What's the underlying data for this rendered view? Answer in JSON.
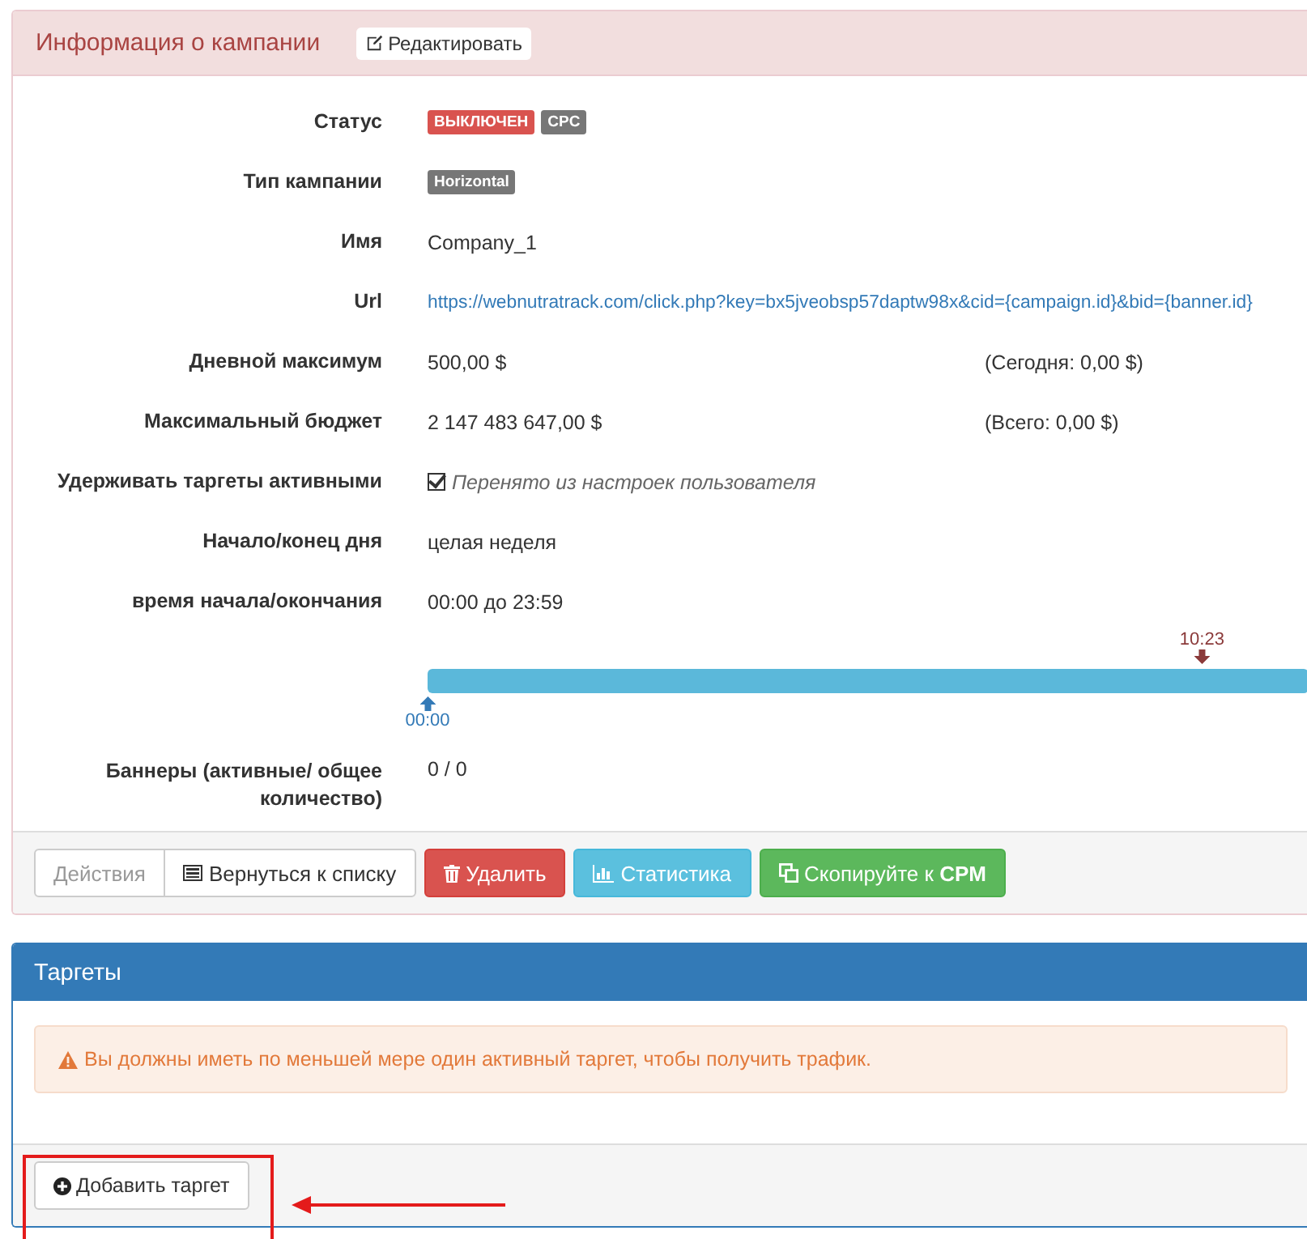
{
  "info_panel": {
    "title": "Информация о кампании",
    "edit_button": "Редактировать",
    "rows": [
      {
        "kind": "badges",
        "label": "Статус",
        "badges": [
          {
            "text": "ВЫКЛЮЧЕН",
            "color": "#d9534f"
          },
          {
            "text": "CPC",
            "color": "#777777"
          }
        ]
      },
      {
        "kind": "badges",
        "label": "Тип кампании",
        "badges": [
          {
            "text": "Horizontal",
            "color": "#777777"
          }
        ]
      },
      {
        "kind": "text",
        "label": "Имя",
        "value": "Company_1"
      },
      {
        "kind": "link",
        "label": "Url",
        "value": "https://webnutratrack.com/click.php?key=bx5jveobsp57daptw98x&cid={campaign.id}&bid={banner.id}"
      },
      {
        "kind": "amount",
        "label": "Дневной максимум",
        "value": "500,00 $",
        "note": "(Сегодня: 0,00 $)"
      },
      {
        "kind": "amount",
        "label": "Максимальный бюджет",
        "value": "2 147 483 647,00 $",
        "note": "(Всего: 0,00 $)"
      },
      {
        "kind": "check",
        "label": "Удерживать таргеты активными",
        "checked": true,
        "value": "Перенято из настроек пользователя"
      },
      {
        "kind": "text",
        "label": "Начало/конец дня",
        "value": "целая неделя"
      },
      {
        "kind": "text",
        "label": "время начала/окончания",
        "value": "00:00 до 23:59"
      },
      {
        "kind": "timeline",
        "now_label": "10:23",
        "level": 0.879,
        "start_label": "00:00"
      },
      {
        "kind": "text",
        "label": "Баннеры (активные/ общее количество)",
        "value": "0 / 0"
      }
    ],
    "actions": [
      {
        "kind": "muted",
        "label": "Действия"
      },
      {
        "kind": "default",
        "label": "Вернуться к списку"
      },
      {
        "kind": "danger",
        "label": "Удалить"
      },
      {
        "kind": "info",
        "label": "Статистика"
      },
      {
        "kind": "success",
        "label": "Скопируйте к **CPM**"
      }
    ]
  },
  "targets_panel": {
    "title": "Таргеты",
    "alert": "Вы должны иметь по меньшей мере один активный таргет, чтобы получить трафик.",
    "add_button": "Добавить таргет"
  }
}
